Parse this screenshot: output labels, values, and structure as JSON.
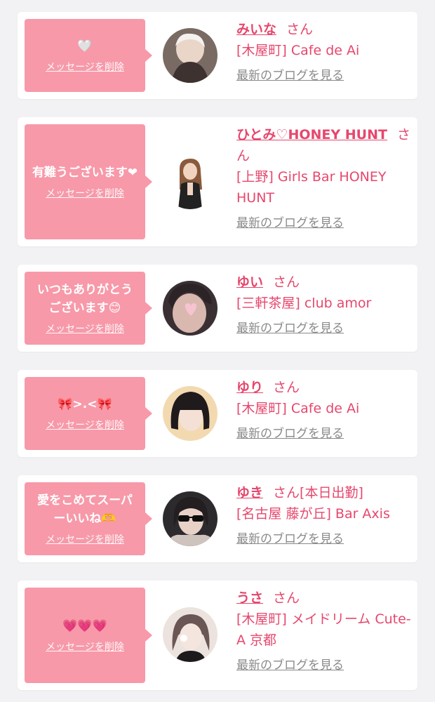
{
  "cards": [
    {
      "message": "🤍",
      "delete_label": "メッセージを削除",
      "name": "みいな",
      "honorific": "さん",
      "extra": "",
      "shop": "[木屋町] Cafe de Ai",
      "blog_label": "最新のブログを見る",
      "avatar_colors": [
        "#6b5a55",
        "#d8c2b4"
      ]
    },
    {
      "message": "有難うございます❤",
      "delete_label": "メッセージを削除",
      "name": "ひとみ♡HONEY HUNT",
      "honorific": "さん",
      "extra": "",
      "shop": "[上野] Girls Bar HONEY HUNT",
      "blog_label": "最新のブログを見る",
      "avatar_colors": [
        "#ffffff",
        "#2a2a2a"
      ]
    },
    {
      "message": "いつもありがとうございます😊",
      "delete_label": "メッセージを削除",
      "name": "ゆい",
      "honorific": "さん",
      "extra": "",
      "shop": "[三軒茶屋] club amor",
      "blog_label": "最新のブログを見る",
      "avatar_colors": [
        "#3c3438",
        "#f1c9d2"
      ]
    },
    {
      "message": "🎀>.<🎀",
      "delete_label": "メッセージを削除",
      "name": "ゆり",
      "honorific": "さん",
      "extra": "",
      "shop": "[木屋町] Cafe de Ai",
      "blog_label": "最新のブログを見る",
      "avatar_colors": [
        "#f3d6a6",
        "#2b2225"
      ]
    },
    {
      "message": "愛をこめてスーパーいいね🫶",
      "delete_label": "メッセージを削除",
      "name": "ゆき",
      "honorific": "さん",
      "extra": "[本日出勤]",
      "shop": "[名古屋 藤が丘] Bar Axis",
      "blog_label": "最新のブログを見る",
      "avatar_colors": [
        "#2e2b2e",
        "#d9c7c1"
      ]
    },
    {
      "message": "💗💗💗",
      "delete_label": "メッセージを削除",
      "name": "うさ",
      "honorific": "さん",
      "extra": "",
      "shop": "[木屋町] メイドリーム Cute-A 京都",
      "blog_label": "最新のブログを見る",
      "avatar_colors": [
        "#e8ddd8",
        "#5a4a4a"
      ]
    }
  ]
}
